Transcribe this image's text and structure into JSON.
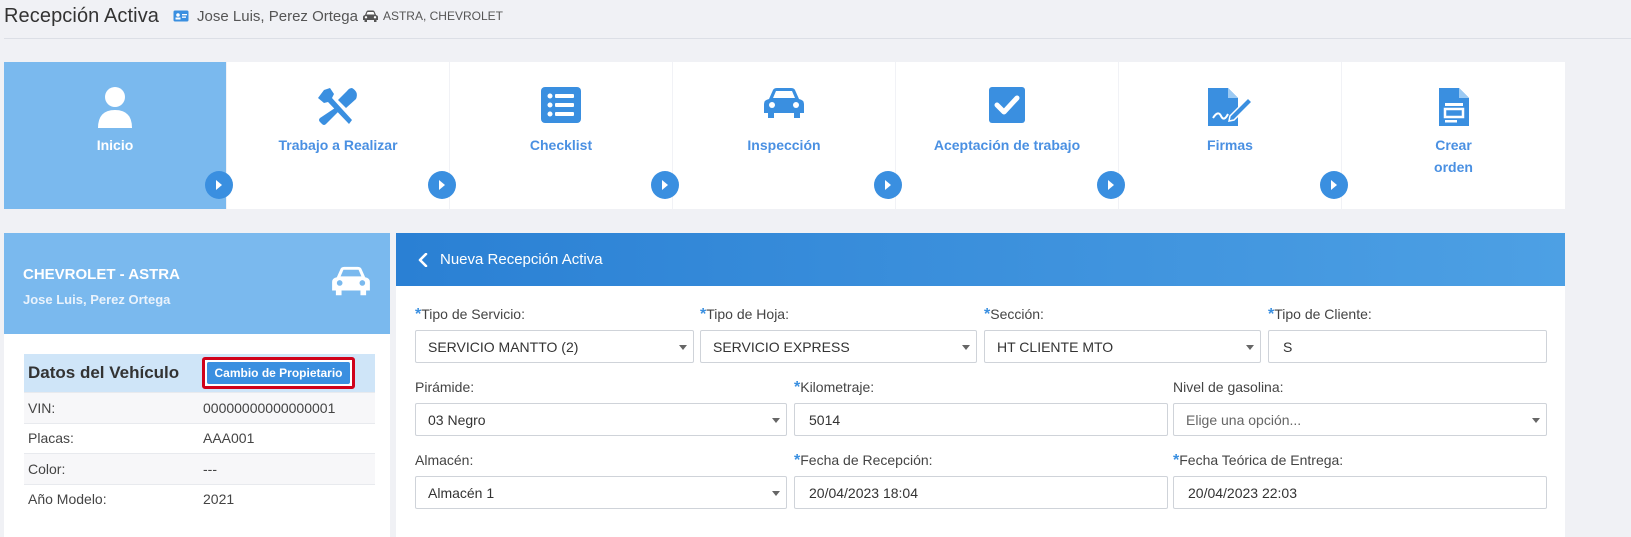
{
  "header": {
    "title": "Recepción Activa",
    "owner": "Jose Luis, Perez Ortega",
    "vehicle": "ASTRA, CHEVROLET"
  },
  "steps": [
    {
      "label": "Inicio",
      "icon": "user-icon"
    },
    {
      "label": "Trabajo a Realizar",
      "icon": "tools-icon"
    },
    {
      "label": "Checklist",
      "icon": "list-icon"
    },
    {
      "label": "Inspección",
      "icon": "car-icon"
    },
    {
      "label": "Aceptación de trabajo",
      "icon": "check-square-icon"
    },
    {
      "label": "Firmas",
      "icon": "signature-icon"
    },
    {
      "label_line1": "Crear",
      "label_line2": "orden",
      "icon": "file-icon"
    }
  ],
  "vehicle_card": {
    "title": "CHEVROLET - ASTRA",
    "owner": "Jose Luis, Perez Ortega",
    "section_title": "Datos del Vehículo",
    "owner_change_button": "Cambio de Propietario",
    "rows": [
      {
        "label": "VIN:",
        "value": "00000000000000001"
      },
      {
        "label": "Placas:",
        "value": "AAA001"
      },
      {
        "label": "Color:",
        "value": "---"
      },
      {
        "label": "Año Modelo:",
        "value": "2021"
      }
    ]
  },
  "form": {
    "title": "Nueva Recepción Activa",
    "fields": {
      "tipo_servicio": {
        "label": "Tipo de Servicio:",
        "value": "SERVICIO MANTTO (2)"
      },
      "tipo_hoja": {
        "label": "Tipo de Hoja:",
        "value": "SERVICIO EXPRESS"
      },
      "seccion": {
        "label": "Sección:",
        "value": "HT CLIENTE MTO"
      },
      "tipo_cliente": {
        "label": "Tipo de Cliente:",
        "value": "S"
      },
      "piramide": {
        "label": "Pirámide:",
        "value": "03 Negro"
      },
      "kilometraje": {
        "label": "Kilometraje:",
        "value": "5014"
      },
      "nivel_gasolina": {
        "label": "Nivel de gasolina:",
        "placeholder": "Elige una opción..."
      },
      "almacen": {
        "label": "Almacén:",
        "value": "Almacén 1"
      },
      "fecha_recepcion": {
        "label": "Fecha de Recepción:",
        "value": "20/04/2023 18:04"
      },
      "fecha_entrega": {
        "label": "Fecha Teórica de Entrega:",
        "value": "20/04/2023 22:03"
      }
    },
    "required_mark": "*"
  },
  "colors": {
    "accent": "#3a8fe0",
    "active_step": "#7ab9ee",
    "highlight_border": "#d0021b"
  }
}
